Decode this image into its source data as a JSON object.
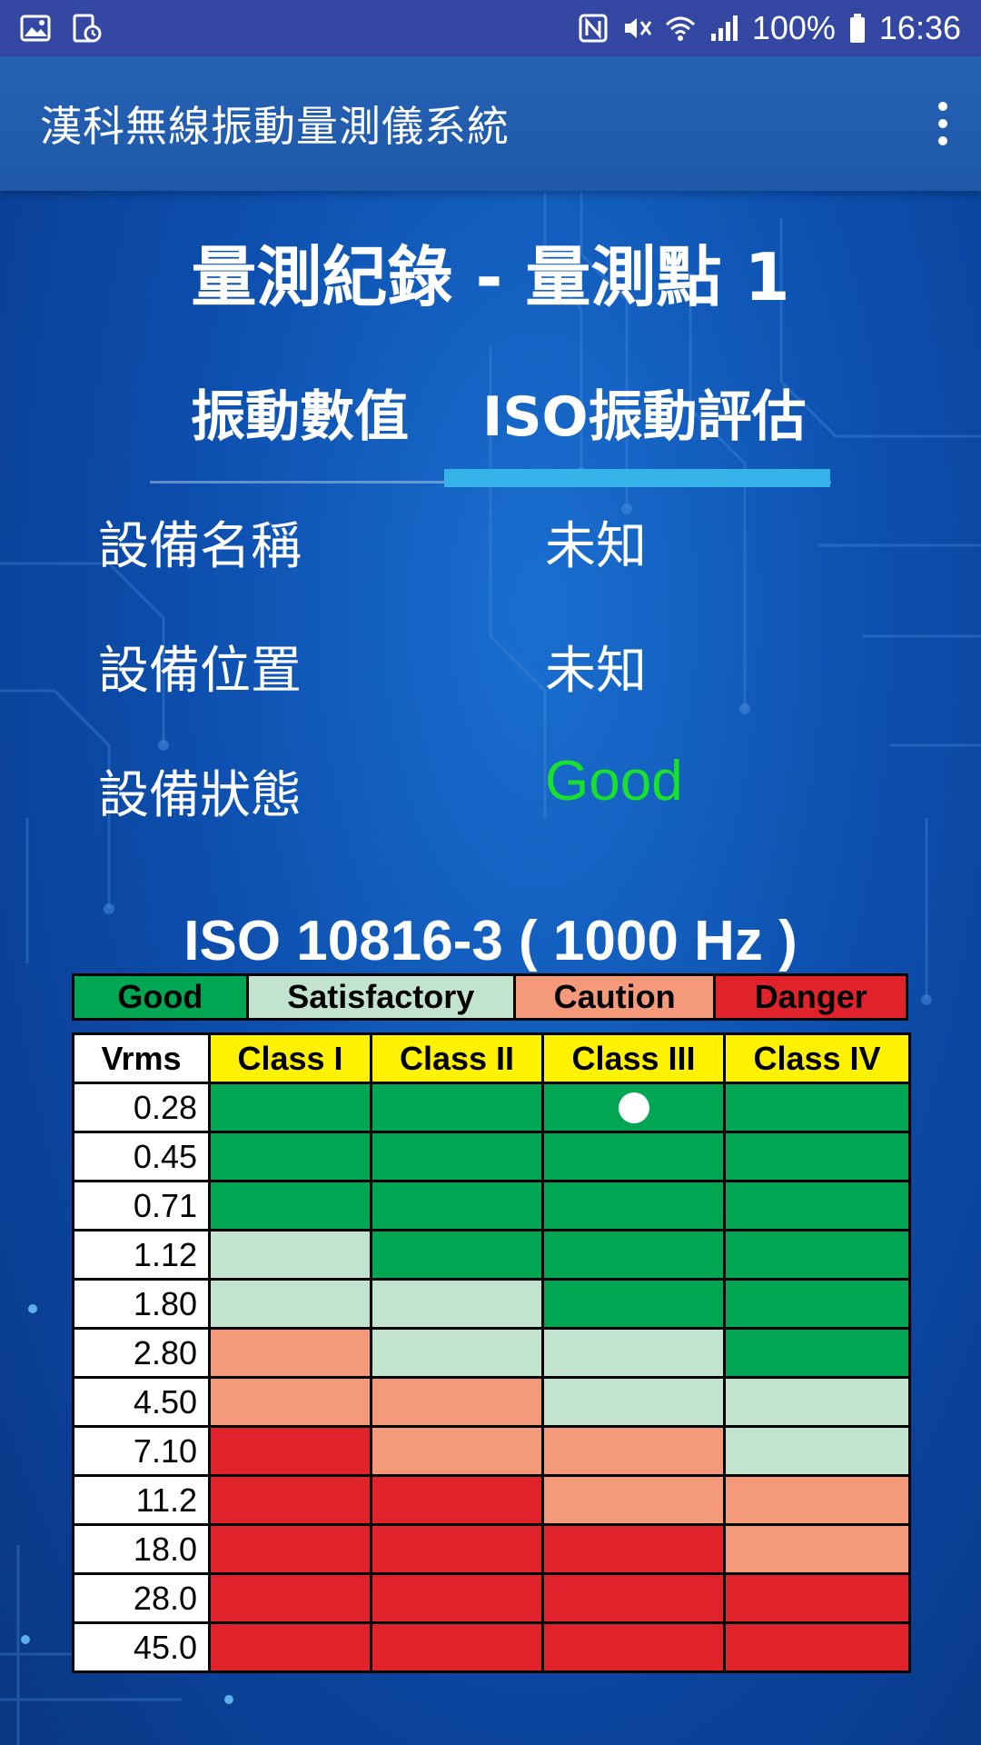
{
  "status_bar": {
    "battery": "100%",
    "time": "16:36",
    "icons": [
      "gallery-icon",
      "screen-time-icon",
      "nfc-icon",
      "mute-vibrate-icon",
      "wifi-icon",
      "signal-icon",
      "battery-icon"
    ]
  },
  "app_bar": {
    "title": "漢科無線振動量測儀系統",
    "menu_icon": "more-vert-icon"
  },
  "page_title": "量測紀錄 - 量測點 1",
  "tabs": [
    {
      "label": "振動數值",
      "selected": false
    },
    {
      "label": "ISO振動評估",
      "selected": true
    }
  ],
  "info": {
    "device_name_label": "設備名稱",
    "device_name_value": "未知",
    "device_location_label": "設備位置",
    "device_location_value": "未知",
    "device_status_label": "設備狀態",
    "device_status_value": "Good"
  },
  "iso": {
    "title": "ISO 10816-3 ( 1000 Hz )",
    "legend": [
      {
        "label": "Good",
        "color": "#00a651"
      },
      {
        "label": "Satisfactory",
        "color": "#c2e3cd"
      },
      {
        "label": "Caution",
        "color": "#f4997a"
      },
      {
        "label": "Danger",
        "color": "#e0232a"
      }
    ],
    "header_vrms": "Vrms",
    "columns": [
      "Class I",
      "Class II",
      "Class III",
      "Class IV"
    ],
    "rows": [
      {
        "vrms": "0.28",
        "levels": [
          "G",
          "G",
          "G",
          "G"
        ]
      },
      {
        "vrms": "0.45",
        "levels": [
          "G",
          "G",
          "G",
          "G"
        ]
      },
      {
        "vrms": "0.71",
        "levels": [
          "G",
          "G",
          "G",
          "G"
        ]
      },
      {
        "vrms": "1.12",
        "levels": [
          "S",
          "G",
          "G",
          "G"
        ]
      },
      {
        "vrms": "1.80",
        "levels": [
          "S",
          "S",
          "G",
          "G"
        ]
      },
      {
        "vrms": "2.80",
        "levels": [
          "C",
          "S",
          "S",
          "G"
        ]
      },
      {
        "vrms": "4.50",
        "levels": [
          "C",
          "C",
          "S",
          "S"
        ]
      },
      {
        "vrms": "7.10",
        "levels": [
          "D",
          "C",
          "C",
          "S"
        ]
      },
      {
        "vrms": "11.2",
        "levels": [
          "D",
          "D",
          "C",
          "C"
        ]
      },
      {
        "vrms": "18.0",
        "levels": [
          "D",
          "D",
          "D",
          "C"
        ]
      },
      {
        "vrms": "28.0",
        "levels": [
          "D",
          "D",
          "D",
          "D"
        ]
      },
      {
        "vrms": "45.0",
        "levels": [
          "D",
          "D",
          "D",
          "D"
        ]
      }
    ],
    "marker": {
      "row": 0,
      "col": 2
    }
  }
}
